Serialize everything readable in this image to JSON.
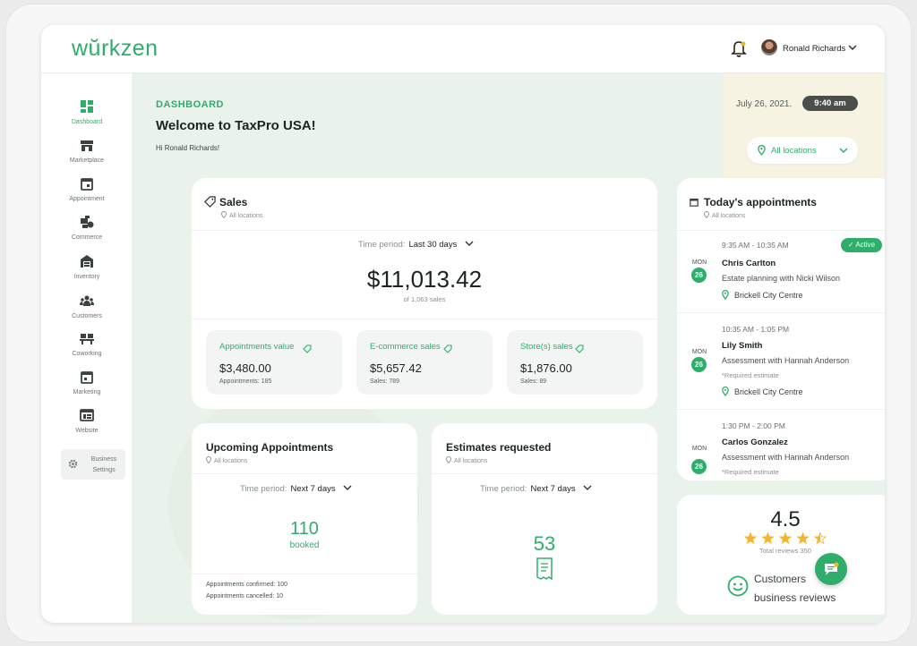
{
  "brand": {
    "logo": "wŭrkzen",
    "accent": "#2fae6b"
  },
  "header": {
    "user_name": "Ronald Richards"
  },
  "sidebar": {
    "items": [
      {
        "label": "Dashboard",
        "icon": "dashboard-icon",
        "active": true
      },
      {
        "label": "Marketplace",
        "icon": "store-icon"
      },
      {
        "label": "Appointment",
        "icon": "calendar-icon"
      },
      {
        "label": "Commerce",
        "icon": "commerce-icon"
      },
      {
        "label": "Inventory",
        "icon": "warehouse-icon"
      },
      {
        "label": "Customers",
        "icon": "users-icon"
      },
      {
        "label": "Coworking",
        "icon": "coworking-icon"
      },
      {
        "label": "Marketing",
        "icon": "marketing-calendar-icon"
      },
      {
        "label": "Website",
        "icon": "website-icon"
      }
    ],
    "settings": {
      "line1": "Business",
      "line2": "Settings"
    }
  },
  "page": {
    "section": "DASHBOARD",
    "welcome": "Welcome to TaxPro USA!",
    "greeting": "Hi Ronald Richards!",
    "date": "July 26, 2021.",
    "time": "9:40 am",
    "location_filter": "All locations"
  },
  "sales": {
    "title": "Sales",
    "subtitle": "All locations",
    "period_label": "Time period:",
    "period_value": "Last 30 days",
    "total": "$11,013.42",
    "count": "of 1,063 sales",
    "breakdown": [
      {
        "label": "Appointments value",
        "value": "$3,480.00",
        "sub": "Appointments: 185"
      },
      {
        "label": "E-commerce sales",
        "value": "$5,657.42",
        "sub": "Sales: 789"
      },
      {
        "label": "Store(s) sales",
        "value": "$1,876.00",
        "sub": "Sales: 89"
      }
    ]
  },
  "upcoming": {
    "title": "Upcoming Appointments",
    "subtitle": "All locations",
    "period_label": "Time period:",
    "period_value": "Next 7 days",
    "count": "110",
    "count_label": "booked",
    "confirmed": "Appointments confirmed: 100",
    "cancelled": "Appointments cancelled: 10"
  },
  "estimates": {
    "title": "Estimates requested",
    "subtitle": "All locations",
    "period_label": "Time period:",
    "period_value": "Next 7 days",
    "count": "53"
  },
  "today": {
    "title": "Today's appointments",
    "subtitle": "All locations",
    "appointments": [
      {
        "time": "9:35 AM - 10:35 AM",
        "name": "Chris Carlton",
        "desc": "Estate planning with Nicki Wilson",
        "note": "",
        "location": "Brickell City Centre",
        "month": "MON",
        "day": "26",
        "badge": "✓ Active"
      },
      {
        "time": "10:35 AM - 1:05 PM",
        "name": "Lily Smith",
        "desc": "Assessment with Hannah Anderson",
        "note": "*Required estimate",
        "location": "Brickell City Centre",
        "month": "MON",
        "day": "26"
      },
      {
        "time": "1:30 PM - 2:00 PM",
        "name": "Carlos Gonzalez",
        "desc": "Assessment with Hannah Anderson",
        "note": "*Required estimate",
        "location": "",
        "month": "MON",
        "day": "26"
      }
    ]
  },
  "reviews": {
    "rating": "4.5",
    "stars": 4.5,
    "total": "Total reviews 350",
    "label_line1": "Customers",
    "label_line2": "business reviews"
  }
}
